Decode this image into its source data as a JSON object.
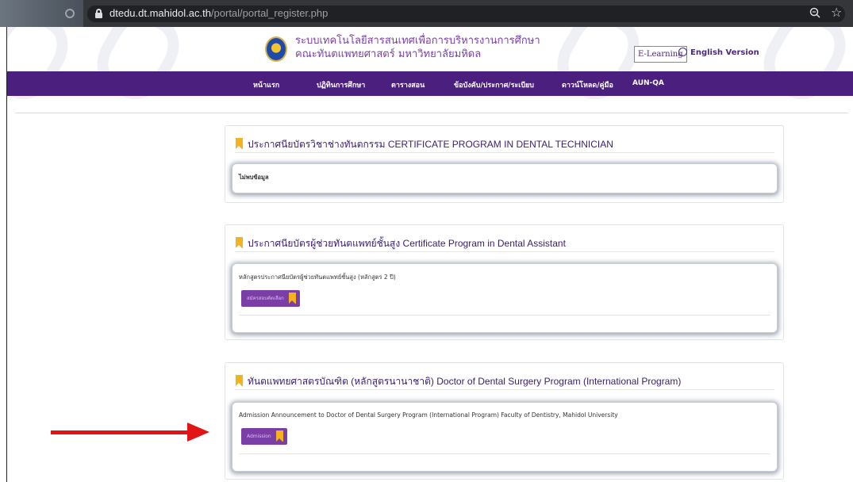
{
  "browser": {
    "url_host": "dtedu.dt.mahidol.ac.th",
    "url_path": "/portal/portal_register.php",
    "icons": [
      "lock-icon",
      "zoom-icon",
      "star-icon"
    ]
  },
  "header": {
    "title_line1": "ระบบเทคโนโลยีสารสนเทศเพื่อการบริหารงานการศึกษา",
    "title_line2": "คณะทันตแพทยศาสตร์ มหาวิทยาลัยมหิดล",
    "elearning_label": "E-Learning",
    "english_label": "English Version"
  },
  "nav": {
    "items": [
      "หน้าแรก",
      "ปฏิทินการศึกษา",
      "ตารางสอน",
      "ข้อบังคับ/ประกาศ/ระเบียบ",
      "ดาวน์โหลด/คู่มือ",
      "AUN-QA"
    ]
  },
  "cards": [
    {
      "title": "ประกาศนียบัตรวิชาช่างทันตกรรม CERTIFICATE PROGRAM IN DENTAL TECHNICIAN",
      "body": "ไม่พบข้อมูล"
    },
    {
      "title": "ประกาศนียบัตรผู้ช่วยทันตแพทย์ชั้นสูง Certificate Program in Dental Assistant",
      "body": "หลักสูตรประกาศนียบัตรผู้ช่วยทันตแพทย์ชั้นสูง (หลักสูตร 2 ปี)",
      "button": "สมัครสอบคัดเลือก"
    },
    {
      "title": "ทันตแพทยศาสตรบัณฑิต (หลักสูตรนานาชาติ) Doctor of Dental Surgery Program (International Program)",
      "body": "Admission Announcement to Doctor of Dental Surgery Program (International Program) Faculty of Dentistry, Mahidol University",
      "button": "Admission"
    }
  ],
  "colors": {
    "nav_bg": "#4a1f7e",
    "accent_purple": "#7b3ea6",
    "ribbon_gold": "#f3b21e",
    "arrow_red": "#e11515"
  }
}
